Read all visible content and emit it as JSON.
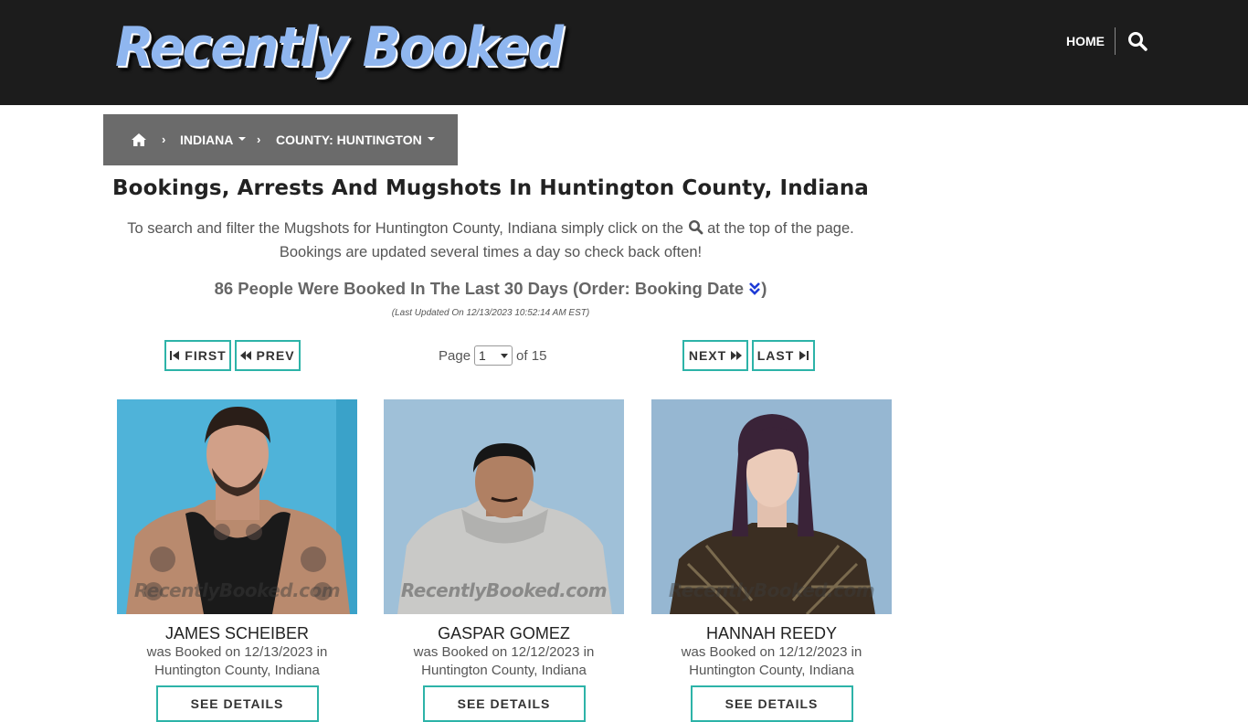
{
  "header": {
    "logo_text": "Recently Booked",
    "nav_home": "HOME",
    "search_icon": "search-icon"
  },
  "breadcrumb": {
    "home_icon": "home-icon",
    "items": [
      {
        "label": "INDIANA"
      },
      {
        "label": "COUNTY: HUNTINGTON"
      }
    ]
  },
  "main": {
    "title": "Bookings, Arrests And Mugshots In Huntington County, Indiana",
    "intro_before": "To search and filter the Mugshots for Huntington County, Indiana simply click on the",
    "intro_after": "at the top of the page.",
    "intro_line2": "Bookings are updated several times a day so check back often!",
    "count_text": "86 People Were Booked In The Last 30 Days (Order: Booking Date",
    "count_close": ")",
    "updated": "(Last Updated On 12/13/2023 10:52:14 AM EST)"
  },
  "pager": {
    "first": "FIRST",
    "prev": "PREV",
    "next": "NEXT",
    "last": "LAST",
    "page_label": "Page",
    "page_value": "1",
    "of_label": "of 15"
  },
  "bookings": [
    {
      "name": "JAMES SCHEIBER",
      "desc": "was Booked on 12/13/2023 in Huntington County, Indiana",
      "button": "SEE DETAILS",
      "watermark": "RecentlyBooked.com",
      "bg": "#4fb3d9"
    },
    {
      "name": "GASPAR GOMEZ",
      "desc": "was Booked on 12/12/2023 in Huntington County, Indiana",
      "button": "SEE DETAILS",
      "watermark": "RecentlyBooked.com",
      "bg": "#9fc0d8"
    },
    {
      "name": "HANNAH REEDY",
      "desc": "was Booked on 12/12/2023 in Huntington County, Indiana",
      "button": "SEE DETAILS",
      "watermark": "RecentlyBooked.com",
      "bg": "#96b7d2"
    }
  ],
  "colors": {
    "topbar": "#1c1c1c",
    "breadcrumb": "#6b6b6b",
    "accent": "#2db3a8",
    "chevron_blue": "#1e3bd6"
  }
}
